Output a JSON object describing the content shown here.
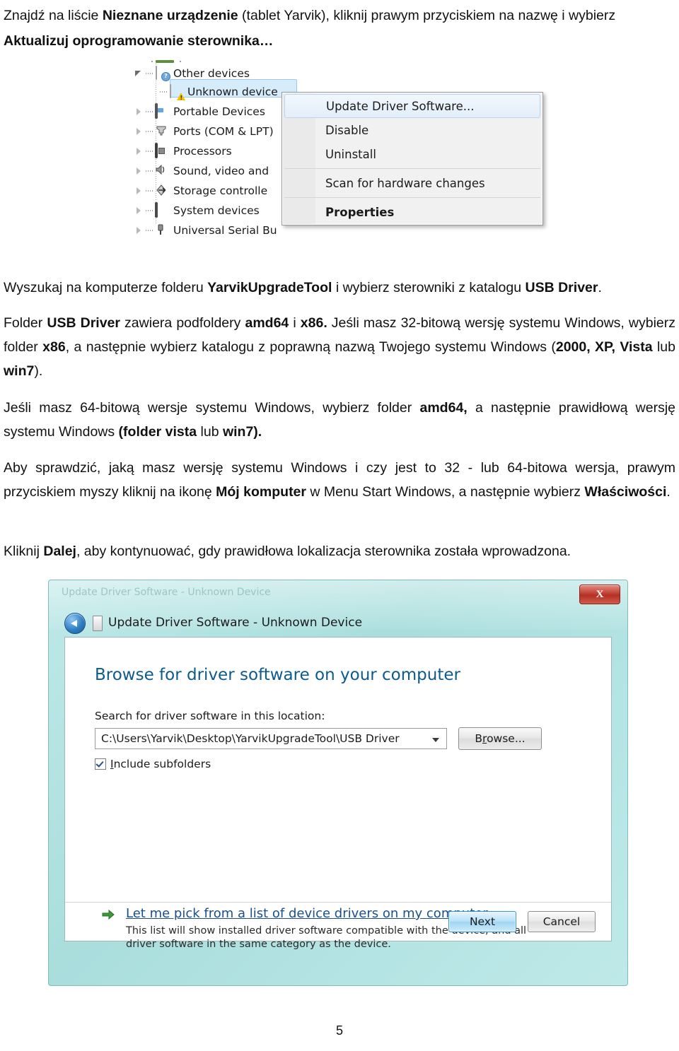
{
  "page": {
    "number": "5",
    "language": "pl"
  },
  "intro": {
    "line1_pre": "Znajdź na liście ",
    "line1_bold": "Nieznane urządzenie",
    "line1_post": " (tablet Yarvik), kliknij prawym przyciskiem na nazwę i wybierz",
    "line2_bold": "Aktualizuj oprogramowanie sterownika…"
  },
  "device_manager": {
    "tree": [
      {
        "label": "Other devices",
        "icon": "device-question-icon",
        "expander": "expanded",
        "selected": false
      },
      {
        "label": "Unknown device",
        "icon": "device-warning-icon",
        "expander": "leaf",
        "selected": true
      },
      {
        "label": "Portable Devices",
        "icon": "portable-device-icon",
        "expander": "collapsed",
        "selected": false
      },
      {
        "label": "Ports (COM & LPT)",
        "icon": "port-icon",
        "expander": "collapsed",
        "selected": false
      },
      {
        "label": "Processors",
        "icon": "processor-icon",
        "expander": "collapsed",
        "selected": false
      },
      {
        "label": "Sound, video and game controllers",
        "icon": "speaker-icon",
        "expander": "collapsed",
        "selected": false
      },
      {
        "label": "Storage controllers",
        "icon": "storage-controller-icon",
        "expander": "collapsed",
        "selected": false
      },
      {
        "label": "System devices",
        "icon": "system-device-icon",
        "expander": "collapsed",
        "selected": false
      },
      {
        "label": "Universal Serial Bus controllers",
        "icon": "usb-icon",
        "expander": "collapsed",
        "selected": false
      }
    ],
    "context_menu": [
      {
        "label": "Update Driver Software...",
        "highlighted": true,
        "bold": false,
        "separator_after": false
      },
      {
        "label": "Disable",
        "highlighted": false,
        "bold": false,
        "separator_after": false
      },
      {
        "label": "Uninstall",
        "highlighted": false,
        "bold": false,
        "separator_after": true
      },
      {
        "label": "Scan for hardware changes",
        "highlighted": false,
        "bold": false,
        "separator_after": true
      },
      {
        "label": "Properties",
        "highlighted": false,
        "bold": true,
        "separator_after": false
      }
    ]
  },
  "paragraphs": {
    "p1": {
      "parts": [
        {
          "t": "Wyszukaj na komputerze folderu ",
          "b": false
        },
        {
          "t": "YarvikUpgradeTool",
          "b": true
        },
        {
          "t": " i wybierz sterowniki z katalogu ",
          "b": false
        },
        {
          "t": "USB Driver",
          "b": true
        },
        {
          "t": ".",
          "b": false
        }
      ]
    },
    "p2": {
      "parts": [
        {
          "t": "Folder ",
          "b": false
        },
        {
          "t": "USB Driver",
          "b": true
        },
        {
          "t": " zawiera podfoldery ",
          "b": false
        },
        {
          "t": "amd64",
          "b": true
        },
        {
          "t": " i ",
          "b": false
        },
        {
          "t": "x86.",
          "b": true
        },
        {
          "t": " Jeśli masz 32-bitową wersję systemu Windows, wybierz folder ",
          "b": false
        },
        {
          "t": "x86",
          "b": true
        },
        {
          "t": ", a następnie wybierz katalogu z poprawną nazwą Twojego systemu Windows (",
          "b": false
        },
        {
          "t": "2000, XP, Vista",
          "b": true
        },
        {
          "t": " lub ",
          "b": false
        },
        {
          "t": "win7",
          "b": true
        },
        {
          "t": ").",
          "b": false
        }
      ]
    },
    "p3": {
      "parts": [
        {
          "t": "Jeśli masz 64-bitową wersje systemu Windows, wybierz folder ",
          "b": false
        },
        {
          "t": "amd64,",
          "b": true
        },
        {
          "t": " a następnie prawidłową wersję systemu Windows ",
          "b": false
        },
        {
          "t": "(folder ",
          "b": true
        },
        {
          "t": "vista",
          "b": true
        },
        {
          "t": " lub ",
          "b": false
        },
        {
          "t": "win7).",
          "b": true
        }
      ]
    },
    "p4": {
      "parts": [
        {
          "t": "Aby sprawdzić, jaką masz wersję systemu Windows i czy jest to 32 - lub 64-bitowa wersja, prawym przyciskiem myszy kliknij na ikonę ",
          "b": false
        },
        {
          "t": "Mój komputer",
          "b": true
        },
        {
          "t": " w Menu Start Windows, a następnie wybierz ",
          "b": false
        },
        {
          "t": "Właściwości",
          "b": true
        },
        {
          "t": ".",
          "b": false
        }
      ]
    },
    "p5": {
      "parts": [
        {
          "t": "Kliknij ",
          "b": false
        },
        {
          "t": "Dalej",
          "b": true
        },
        {
          "t": ", aby kontynuować, gdy prawidłowa lokalizacja sterownika została wprowadzona.",
          "b": false
        }
      ]
    }
  },
  "wizard": {
    "ghost_text": "Update Driver Software - Unknown Device",
    "close_label": "X",
    "title": "Update Driver Software - Unknown Device",
    "heading": "Browse for driver software on your computer",
    "location_label": "Search for driver software in this location:",
    "location_value": "C:\\Users\\Yarvik\\Desktop\\YarvikUpgradeTool\\USB Driver",
    "browse_label_pre": "B",
    "browse_label_underlined": "r",
    "browse_label_post": "owse...",
    "include_subfolders_underlined": "I",
    "include_subfolders_rest": "nclude subfolders",
    "include_subfolders_checked": true,
    "pick_link_underlined": "L",
    "pick_link_rest": "et me pick from a list of device drivers on my computer",
    "pick_desc": "This list will show installed driver software compatible with the device, and all driver software in the same category as the device.",
    "next_label": "Next",
    "cancel_label": "Cancel"
  },
  "colors": {
    "accent_blue": "#1a4f8a",
    "heading_blue": "#0d5a8c",
    "glass_teal": "#a9dedd",
    "close_red": "#b63025",
    "selection_blue": "#d6ecfb",
    "green_arrow": "#3d9b35"
  }
}
